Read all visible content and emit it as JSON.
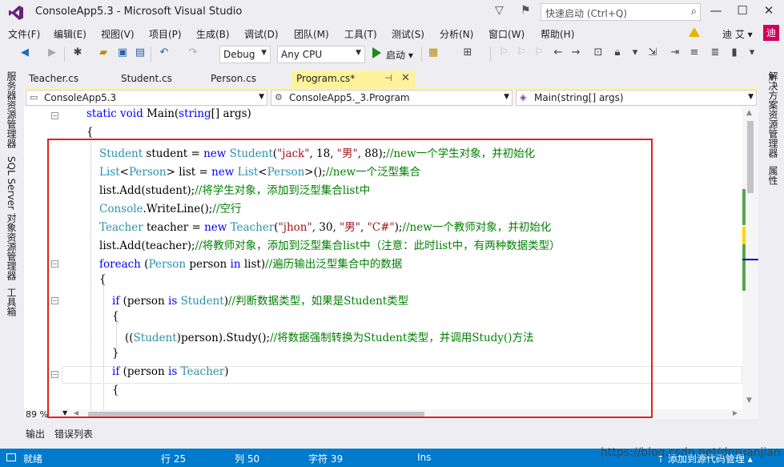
{
  "window": {
    "title": "ConsoleApp5.3 - Microsoft Visual Studio",
    "quick_launch_placeholder": "快速启动 (Ctrl+Q)",
    "icons": [
      "vs-logo-icon",
      "filter-icon",
      "notification-icon",
      "search-icon",
      "minimize-icon",
      "maximize-icon",
      "close-icon"
    ]
  },
  "menu": {
    "items": [
      "文件(F)",
      "编辑(E)",
      "视图(V)",
      "项目(P)",
      "生成(B)",
      "调试(D)",
      "团队(M)",
      "工具(T)",
      "测试(S)",
      "分析(N)",
      "窗口(W)",
      "帮助(H)"
    ],
    "user_name": "迪 艾 ▾",
    "user_avatar": "迪"
  },
  "toolbar": {
    "configuration": "Debug",
    "platform": "Any CPU",
    "start_label": "启动 ▾"
  },
  "side_panels": {
    "left": [
      "服务器资源管理器",
      "SQL Server 对象资源管理器",
      "工具箱"
    ],
    "right": [
      "解决方案资源管理器",
      "属性"
    ]
  },
  "doc_tabs": [
    {
      "label": "Teacher.cs",
      "active": false
    },
    {
      "label": "Student.cs",
      "active": false
    },
    {
      "label": "Person.cs",
      "active": false
    },
    {
      "label": "Program.cs*",
      "active": true
    }
  ],
  "nav": {
    "project": "ConsoleApp5.3",
    "class": "ConsoleApp5._3.Program",
    "member": "Main(string[] args)"
  },
  "code_lines": [
    [
      {
        "t": "static ",
        "c": "kw"
      },
      {
        "t": "void ",
        "c": "kw"
      },
      {
        "t": "Main(",
        "c": ""
      },
      {
        "t": "string",
        "c": "kw"
      },
      {
        "t": "[] args)",
        "c": ""
      }
    ],
    [
      {
        "t": "{",
        "c": ""
      }
    ],
    [
      {
        "t": "Student",
        "c": "ty"
      },
      {
        "t": " student = ",
        "c": ""
      },
      {
        "t": "new ",
        "c": "kw"
      },
      {
        "t": "Student",
        "c": "ty"
      },
      {
        "t": "(",
        "c": ""
      },
      {
        "t": "\"jack\"",
        "c": "st"
      },
      {
        "t": ", 18, ",
        "c": ""
      },
      {
        "t": "\"男\"",
        "c": "st"
      },
      {
        "t": ", 88);",
        "c": ""
      },
      {
        "t": "//new一个学生对象，并初始化",
        "c": "cm"
      }
    ],
    [
      {
        "t": "List",
        "c": "ty"
      },
      {
        "t": "<",
        "c": ""
      },
      {
        "t": "Person",
        "c": "ty"
      },
      {
        "t": "> list = ",
        "c": ""
      },
      {
        "t": "new ",
        "c": "kw"
      },
      {
        "t": "List",
        "c": "ty"
      },
      {
        "t": "<",
        "c": ""
      },
      {
        "t": "Person",
        "c": "ty"
      },
      {
        "t": ">();",
        "c": ""
      },
      {
        "t": "//new一个泛型集合",
        "c": "cm"
      }
    ],
    [
      {
        "t": "list.Add(student);",
        "c": ""
      },
      {
        "t": "//将学生对象，添加到泛型集合list中",
        "c": "cm"
      }
    ],
    [
      {
        "t": "Console",
        "c": "ty"
      },
      {
        "t": ".WriteLine();",
        "c": ""
      },
      {
        "t": "//空行",
        "c": "cm"
      }
    ],
    [
      {
        "t": "Teacher",
        "c": "ty"
      },
      {
        "t": " teacher = ",
        "c": ""
      },
      {
        "t": "new ",
        "c": "kw"
      },
      {
        "t": "Teacher",
        "c": "ty"
      },
      {
        "t": "(",
        "c": ""
      },
      {
        "t": "\"jhon\"",
        "c": "st"
      },
      {
        "t": ", 30, ",
        "c": ""
      },
      {
        "t": "\"男\"",
        "c": "st"
      },
      {
        "t": ", ",
        "c": ""
      },
      {
        "t": "\"C#\"",
        "c": "st"
      },
      {
        "t": ");",
        "c": ""
      },
      {
        "t": "//new一个教师对象，并初始化",
        "c": "cm"
      }
    ],
    [
      {
        "t": "list.Add(teacher);",
        "c": ""
      },
      {
        "t": "//将教师对象，添加到泛型集合list中（注意：此时list中，有两种数据类型）",
        "c": "cm"
      }
    ],
    [
      {
        "t": "foreach ",
        "c": "kw"
      },
      {
        "t": "(",
        "c": ""
      },
      {
        "t": "Person",
        "c": "ty"
      },
      {
        "t": " person ",
        "c": ""
      },
      {
        "t": "in ",
        "c": "kw"
      },
      {
        "t": "list)",
        "c": ""
      },
      {
        "t": "//遍历输出泛型集合中的数据",
        "c": "cm"
      }
    ],
    [
      {
        "t": "{",
        "c": ""
      }
    ],
    [
      {
        "t": "if ",
        "c": "kw"
      },
      {
        "t": "(person ",
        "c": ""
      },
      {
        "t": "is ",
        "c": "kw"
      },
      {
        "t": "Student",
        "c": "ty"
      },
      {
        "t": ")",
        "c": ""
      },
      {
        "t": "//判断数据类型，如果是Student类型",
        "c": "cm"
      }
    ],
    [
      {
        "t": "{",
        "c": ""
      }
    ],
    [
      {
        "t": "((",
        "c": ""
      },
      {
        "t": "Student",
        "c": "ty"
      },
      {
        "t": ")person).Study();",
        "c": ""
      },
      {
        "t": "//将数据强制转换为Student类型，并调用Study()方法",
        "c": "cm"
      }
    ],
    [
      {
        "t": "}",
        "c": ""
      }
    ],
    [
      {
        "t": "if ",
        "c": "kw"
      },
      {
        "t": "(person ",
        "c": ""
      },
      {
        "t": "is ",
        "c": "kw"
      },
      {
        "t": "Teacher",
        "c": "ty"
      },
      {
        "t": ")",
        "c": ""
      }
    ],
    [
      {
        "t": "{",
        "c": ""
      }
    ]
  ],
  "editor": {
    "zoom": "89 %"
  },
  "bottom_tabs": [
    "输出",
    "错误列表"
  ],
  "status": {
    "ready": "就绪",
    "line": "行 25",
    "col": "列 50",
    "char": "字符 39",
    "mode": "Ins",
    "source_control": "↑ 添加到源代码管理 ▴"
  },
  "watermark": "https://blog.csdn.net/dnruanjian",
  "colors": {
    "accent": "#007acc",
    "keyword": "#0000ff",
    "type": "#2b91af",
    "string": "#a31515",
    "comment": "#008000",
    "active_tab": "#fff29d",
    "annotation_box": "#e02020"
  }
}
